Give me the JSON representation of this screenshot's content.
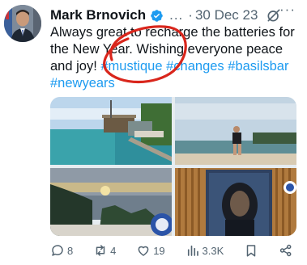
{
  "tweet": {
    "author_name": "Mark Brnovich",
    "header_more": "...",
    "separator": "·",
    "date": "30 Dec 23",
    "more_menu": "···",
    "text_plain": "Always great to recharge the batteries for the New Year. Wishing everyone peace and joy! ",
    "hashtags": [
      "#mustique",
      "#changes",
      "#basilsbar",
      "#newyears"
    ],
    "actions": {
      "replies": "8",
      "reposts": "4",
      "likes": "19",
      "views": "3.3K"
    },
    "colors": {
      "accent": "#1d9bf0",
      "annotation_circle": "#d9261c",
      "muted": "#536471"
    }
  }
}
